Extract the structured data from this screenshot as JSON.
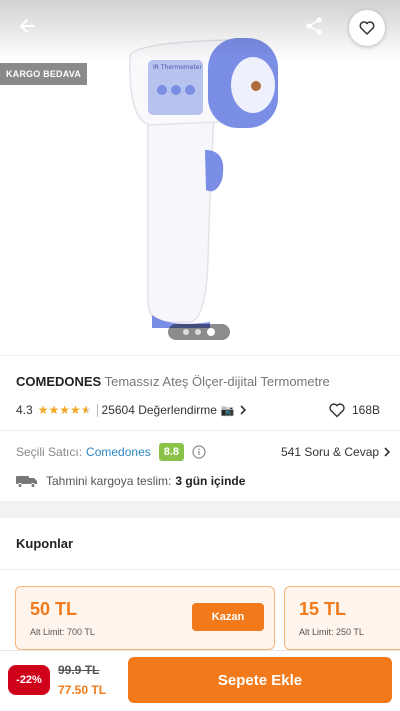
{
  "hero": {
    "badge": "KARGO BEDAVA",
    "device_label": "IR Thermometer",
    "image_count": 3,
    "active_image": 3
  },
  "product": {
    "brand": "COMEDONES",
    "name": "Temassız Ateş Ölçer-dijital Termometre",
    "rating": "4.3",
    "stars": 4.3,
    "reviews": "25604 Değerlendirme",
    "likes": "168B"
  },
  "seller": {
    "label": "Seçili Satıcı:",
    "name": "Comedones",
    "score": "8.8",
    "qa": "541 Soru & Cevap"
  },
  "delivery": {
    "label": "Tahmini kargoya teslim:",
    "value": "3 gün içinde"
  },
  "coupons": {
    "title": "Kuponlar",
    "items": [
      {
        "amount": "50 TL",
        "limit": "Alt Limit: 700 TL",
        "button": "Kazan"
      },
      {
        "amount": "15 TL",
        "limit": "Alt Limit: 250 TL"
      }
    ]
  },
  "bottom": {
    "discount": "-22%",
    "old_price": "99.9 TL",
    "new_price": "77.50 TL",
    "add_to_cart": "Sepete Ekle"
  },
  "colors": {
    "accent": "#f27a1a",
    "discount": "#d0021b",
    "seller_score": "#8bc34a",
    "seller_link": "#2e86c1",
    "device_accent": "#7b8ee6"
  },
  "icons": [
    "back-arrow-icon",
    "share-icon",
    "heart-icon",
    "star-icon",
    "camera-icon",
    "chevron-right-icon",
    "info-icon",
    "truck-icon"
  ]
}
